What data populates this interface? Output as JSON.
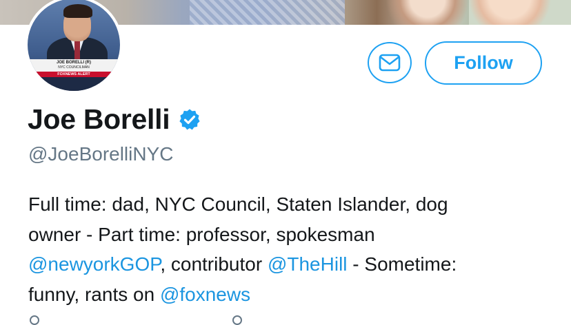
{
  "profile": {
    "name": "Joe Borelli",
    "handle": "@JoeBorelliNYC",
    "verified": true,
    "avatar_chyron": {
      "name_line": "JOE BORELLI (R)",
      "title_line": "NYC COUNCILMAN",
      "alert": "FOXNEWS ALERT"
    }
  },
  "actions": {
    "message_icon": "envelope-icon",
    "follow_label": "Follow"
  },
  "bio": {
    "line1": "Full time: dad, NYC Council, Staten Islander, dog",
    "line2": "owner - Part time: professor, spokesman",
    "link1": "@newyorkGOP",
    "mid1": ", contributor ",
    "link2": "@TheHill",
    "mid2": " - Sometime:",
    "line4_start": "funny, rants on ",
    "link3": "@foxnews"
  },
  "colors": {
    "accent": "#1da1f2",
    "link": "#1b95e0",
    "secondary_text": "#657786"
  }
}
